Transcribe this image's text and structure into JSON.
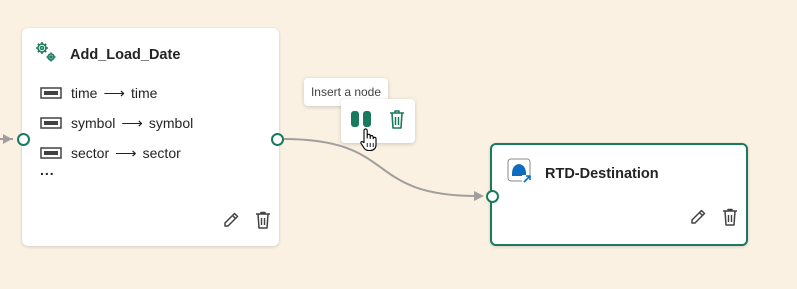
{
  "source_node": {
    "title": "Add_Load_Date",
    "icon": "gear-cluster-icon",
    "fields": [
      {
        "from": "time",
        "arrow": "⟶",
        "to": "time"
      },
      {
        "from": "symbol",
        "arrow": "⟶",
        "to": "symbol"
      },
      {
        "from": "sector",
        "arrow": "⟶",
        "to": "sector"
      }
    ],
    "more": "..."
  },
  "destination_node": {
    "title": "RTD-Destination",
    "icon": "eventhouse-destination-icon"
  },
  "tooltip": {
    "text": "Insert a node"
  },
  "edge_toolbar": {
    "insert_icon": "insert-node-icon",
    "delete_icon": "trash-icon"
  },
  "colors": {
    "canvas": "#faf1e3",
    "accent": "#1a7a5e",
    "edge": "#a19f9d",
    "node_bg": "#ffffff",
    "text": "#242424"
  }
}
